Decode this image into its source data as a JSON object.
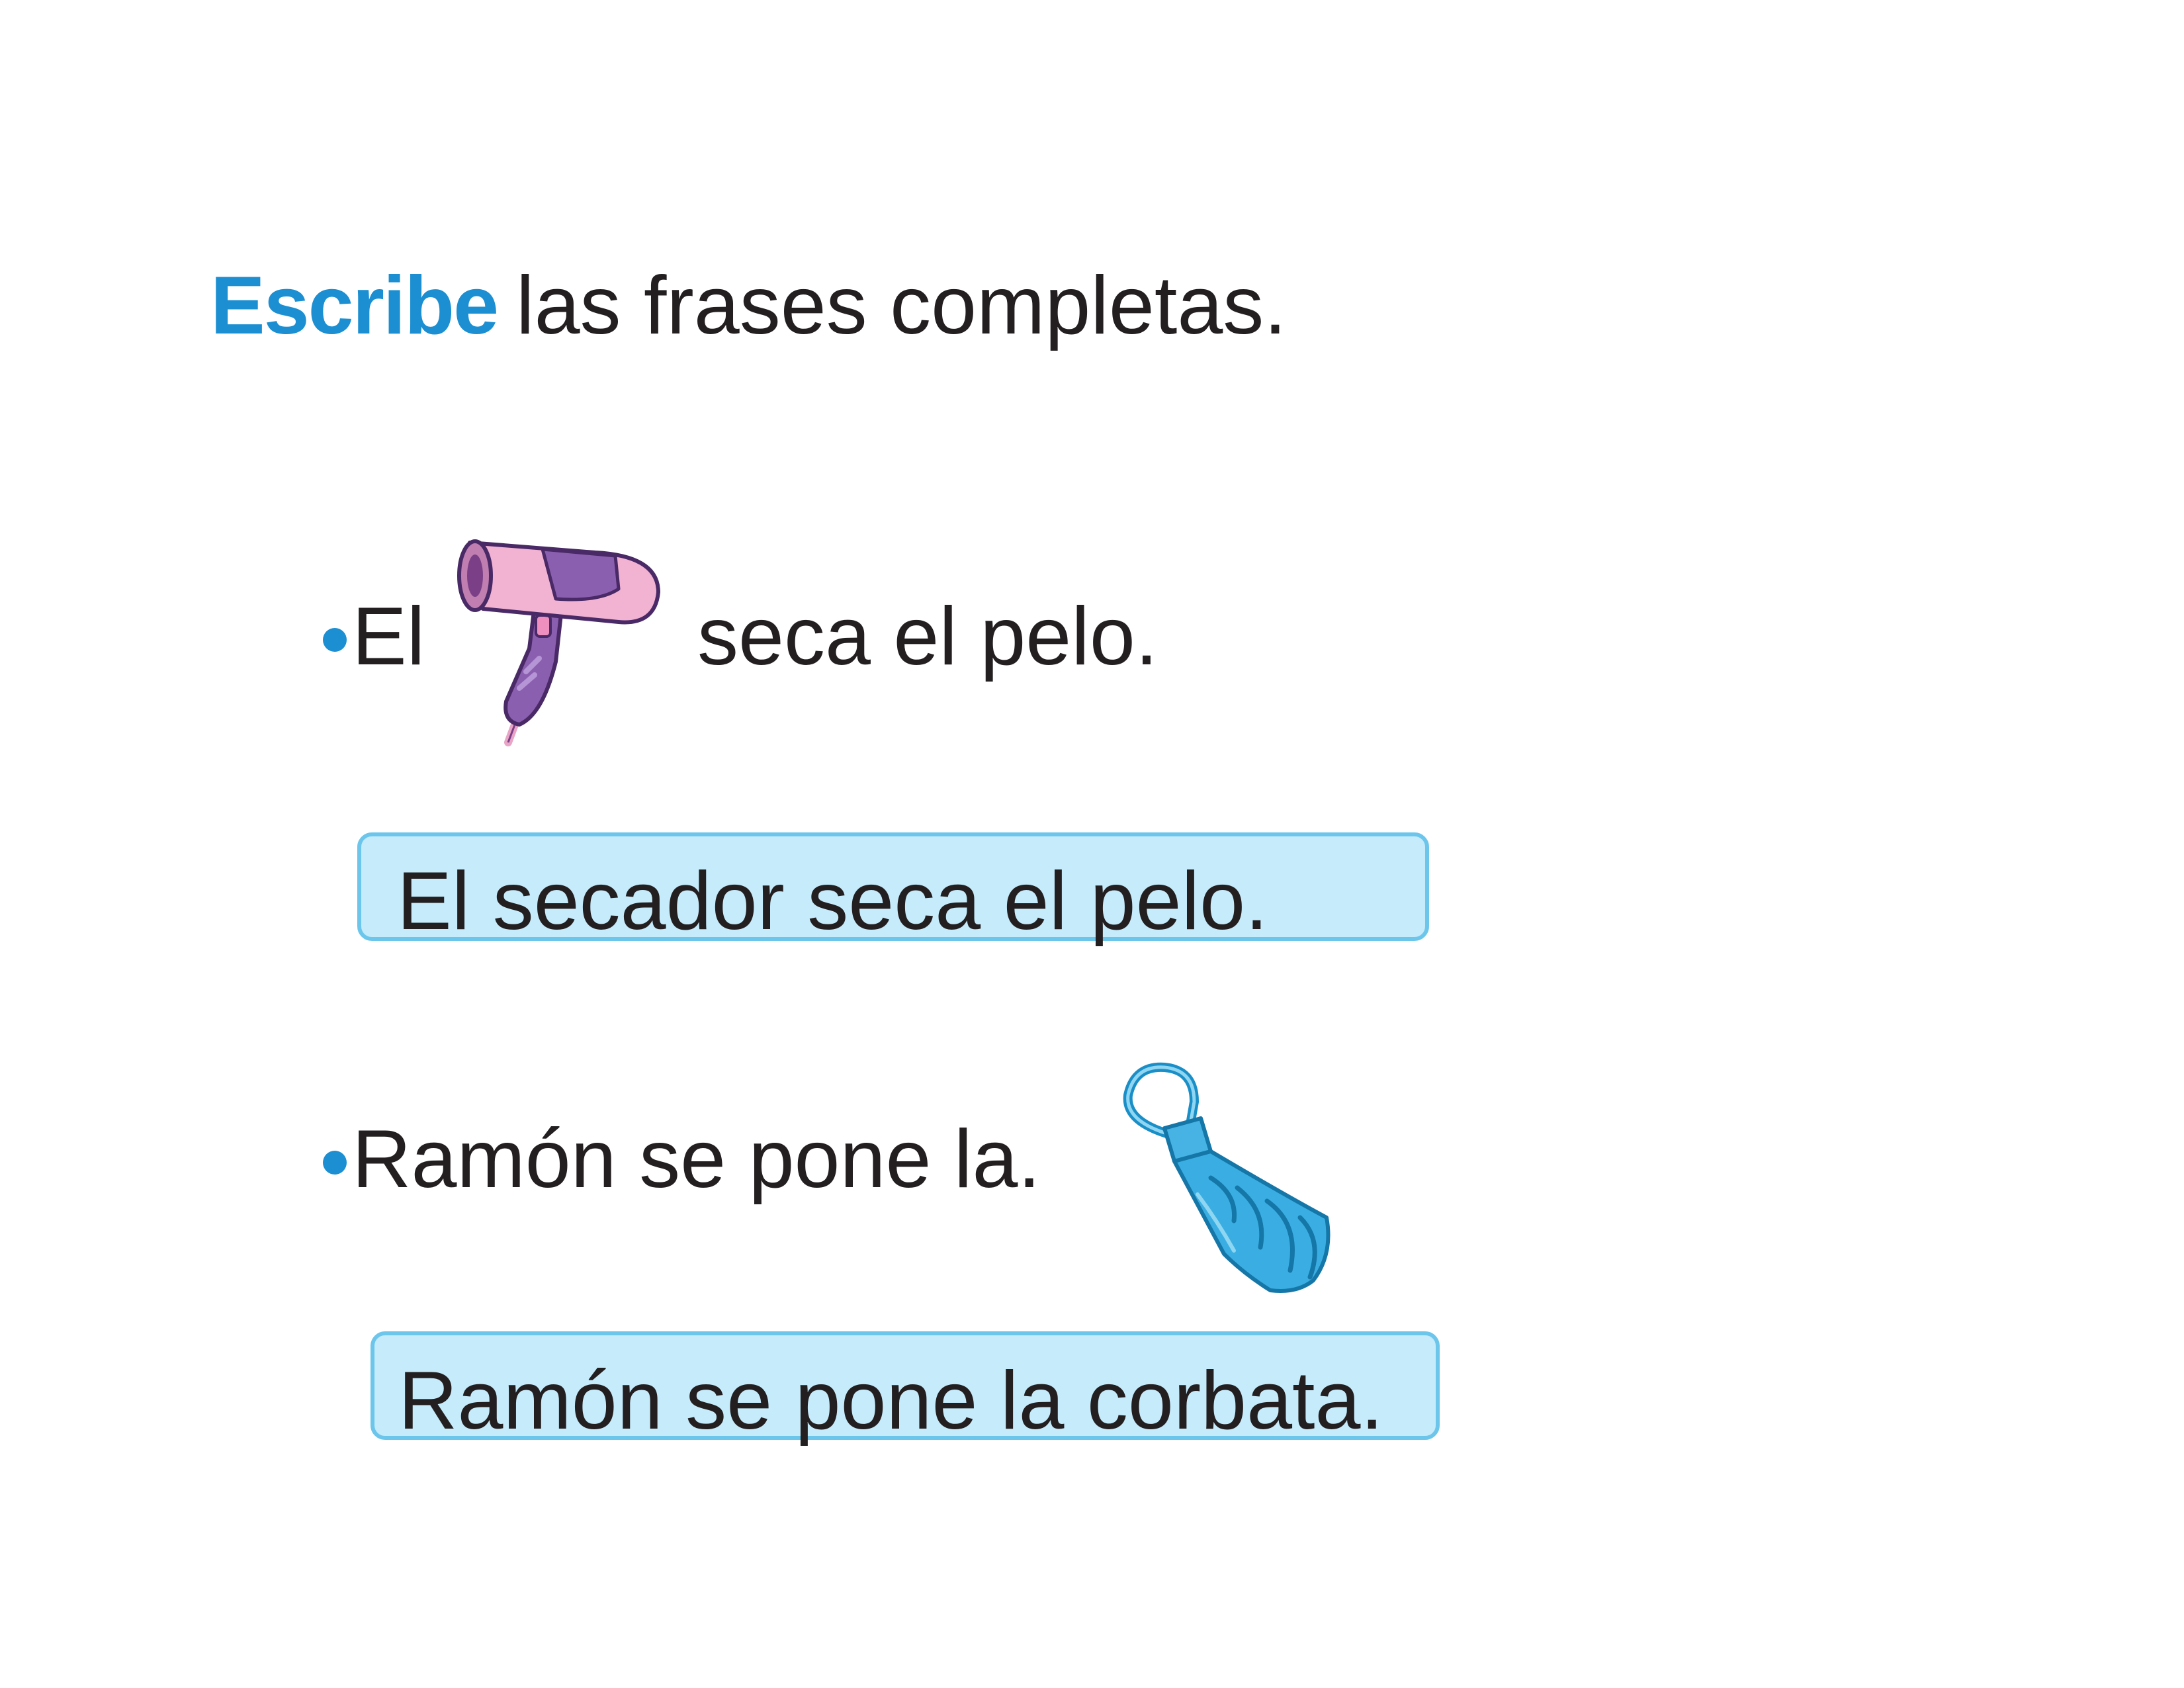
{
  "instruction": {
    "verb": "Escribe",
    "rest": "las frases completas."
  },
  "items": [
    {
      "prompt_before": "El",
      "prompt_after": "seca el pelo.",
      "picture": "hair-dryer-icon",
      "answer": "El secador seca el pelo."
    },
    {
      "prompt_before": "Ramón se pone la.",
      "picture": "necktie-icon",
      "answer": "Ramón se pone la corbata."
    }
  ],
  "colors": {
    "accent": "#1b8fd2",
    "answer_fill": "#c6ebfb",
    "answer_border": "#6cc6ec",
    "text": "#231f20"
  }
}
